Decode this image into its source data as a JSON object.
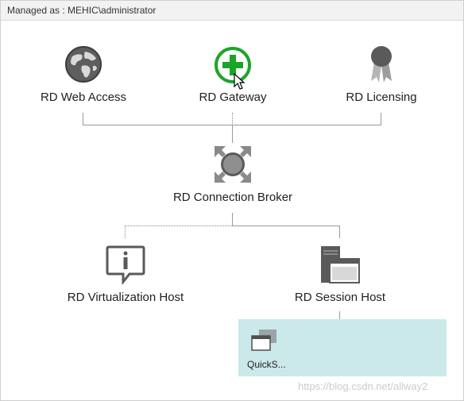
{
  "header": {
    "managed_as": "Managed as : MEHIC\\administrator"
  },
  "roles": {
    "web_access": "RD Web Access",
    "gateway": "RD Gateway",
    "licensing": "RD Licensing",
    "connection_broker": "RD Connection Broker",
    "virtualization_host": "RD Virtualization Host",
    "session_host": "RD Session Host"
  },
  "collection": {
    "label": "QuickS..."
  },
  "watermark": "https://blog.csdn.net/allway2",
  "colors": {
    "gateway_accent": "#19a628",
    "icon_gray": "#6b6b6b",
    "collection_bg": "#cbe8ea"
  }
}
